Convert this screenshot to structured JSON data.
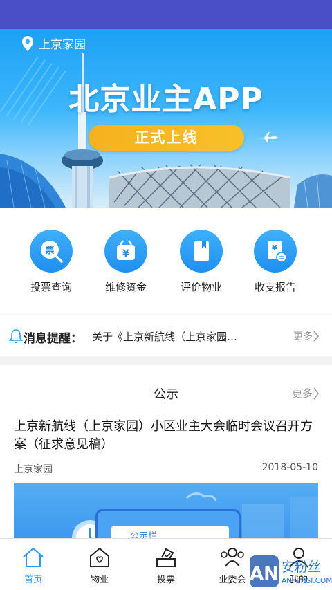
{
  "banner": {
    "location": "上京家园",
    "title": "北京业主APP",
    "tagline": "正式上线"
  },
  "quick_menu": [
    {
      "label": "投票查询",
      "icon": "ticket-search-icon",
      "glyph": "票"
    },
    {
      "label": "维修资金",
      "icon": "maintenance-fund-icon",
      "glyph": "¥"
    },
    {
      "label": "评价物业",
      "icon": "evaluate-book-icon",
      "glyph": ""
    },
    {
      "label": "收支报告",
      "icon": "finance-report-icon",
      "glyph": "¥"
    }
  ],
  "notice": {
    "label": "消息提醒：",
    "message": "关于《上京新航线（上京家园）小区业主大会临时会议召开方案",
    "more": "更多"
  },
  "public_notice": {
    "heading": "公示",
    "more": "更多",
    "item_title": "上京新航线（上京家园）小区业主大会临时会议召开方案（征求意见稿）",
    "source": "上京家园",
    "date": "2018-05-10",
    "thumb_label": "公示栏"
  },
  "tabbar": [
    {
      "label": "首页",
      "icon": "home-icon",
      "active": true
    },
    {
      "label": "物业",
      "icon": "property-house-icon",
      "active": false
    },
    {
      "label": "投票",
      "icon": "vote-box-icon",
      "active": false
    },
    {
      "label": "业委会",
      "icon": "committee-icon",
      "active": false
    },
    {
      "label": "我的",
      "icon": "profile-icon",
      "active": false
    }
  ],
  "watermark": {
    "line1": "安粉丝",
    "line2": "ANFENSI.COM",
    "logo": "AN"
  },
  "colors": {
    "accent": "#2b9af3",
    "status_bar": "#4a4ec7",
    "pill": "#f6b622"
  }
}
